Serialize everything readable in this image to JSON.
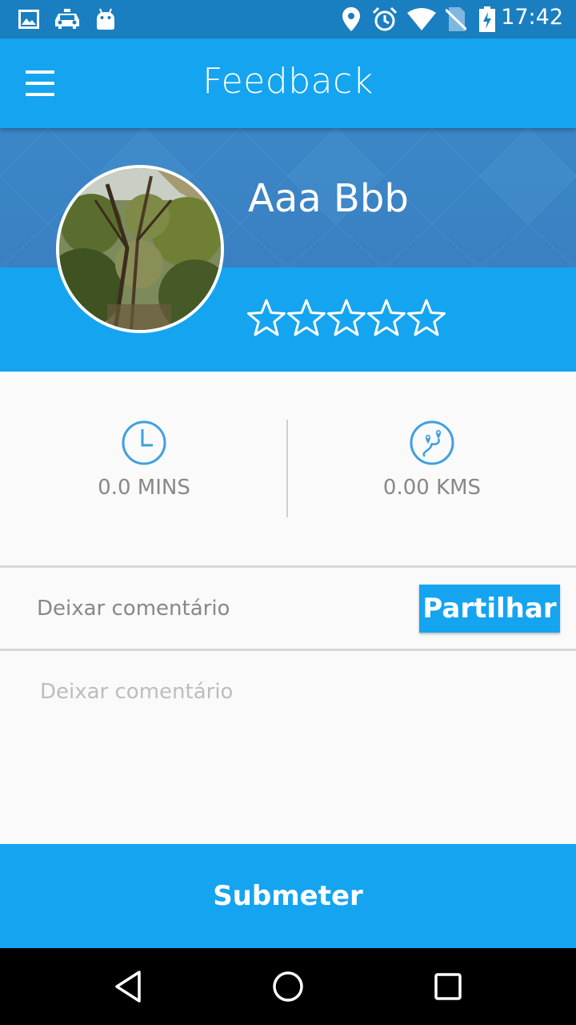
{
  "status_bar": {
    "time": "17:42",
    "icons": [
      "image-icon",
      "taxi-icon",
      "android-icon",
      "location-icon",
      "alarm-icon",
      "wifi-icon",
      "no-sim-icon",
      "battery-charging-icon"
    ]
  },
  "app_bar": {
    "title": "Feedback",
    "menu_icon": "hamburger-menu-icon"
  },
  "profile": {
    "name": "Aaa Bbb",
    "rating": 0,
    "max_rating": 5
  },
  "stats": {
    "duration": {
      "icon": "clock-icon",
      "value": "0.0 MINS"
    },
    "distance": {
      "icon": "route-icon",
      "value": "0.00 KMS"
    }
  },
  "share": {
    "label": "Deixar comentário",
    "button_label": "Partilhar"
  },
  "comment": {
    "placeholder": "Deixar comentário",
    "value": ""
  },
  "submit": {
    "label": "Submeter"
  },
  "colors": {
    "primary": "#15a4f0",
    "status_bar": "#1a7fc0",
    "banner": "#3a84c5",
    "icon_blue": "#3f9fe3",
    "text_gray": "#888888"
  },
  "nav_bar": {
    "icons": [
      "back-icon",
      "home-icon",
      "recents-icon"
    ]
  }
}
